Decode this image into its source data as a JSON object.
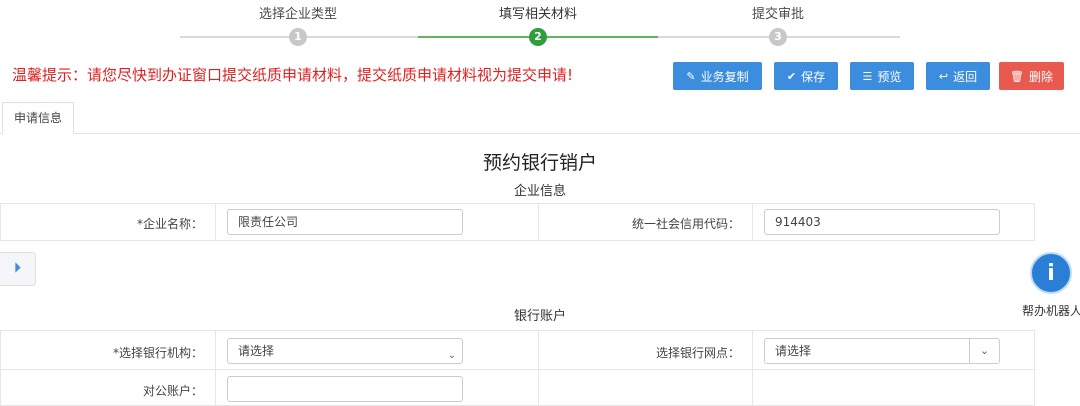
{
  "stepper": {
    "steps": [
      {
        "label": "选择企业类型",
        "number": "1"
      },
      {
        "label": "填写相关材料",
        "number": "2"
      },
      {
        "label": "提交审批",
        "number": "3"
      }
    ]
  },
  "warning": "温馨提示：请您尽快到办证窗口提交纸质申请材料，提交纸质申请材料视为提交申请!",
  "toolbar": {
    "copy_label": "业务复制",
    "save_label": "保存",
    "preview_label": "预览",
    "back_label": "返回",
    "delete_label": "删除"
  },
  "tab": {
    "label": "申请信息"
  },
  "page_title": "预约银行销户",
  "company_section": {
    "title": "企业信息",
    "name_label": "*企业名称：",
    "name_value": "限责任公司",
    "credit_code_label": "统一社会信用代码：",
    "credit_code_value": "914403"
  },
  "bank_section": {
    "title": "银行账户",
    "bank_org_label": "*选择银行机构：",
    "bank_org_value": "请选择",
    "bank_branch_label": "选择银行网点：",
    "bank_branch_value": "请选择",
    "account_label": "对公账户："
  },
  "robot": {
    "label": "帮办机器人",
    "glyph": "i"
  },
  "colors": {
    "accent": "#3c8dde",
    "danger": "#e8594f",
    "success": "#2e9e3e",
    "warning_text": "#e02020"
  },
  "icons": {
    "sidebar_toggle": "collapse-right-icon"
  }
}
